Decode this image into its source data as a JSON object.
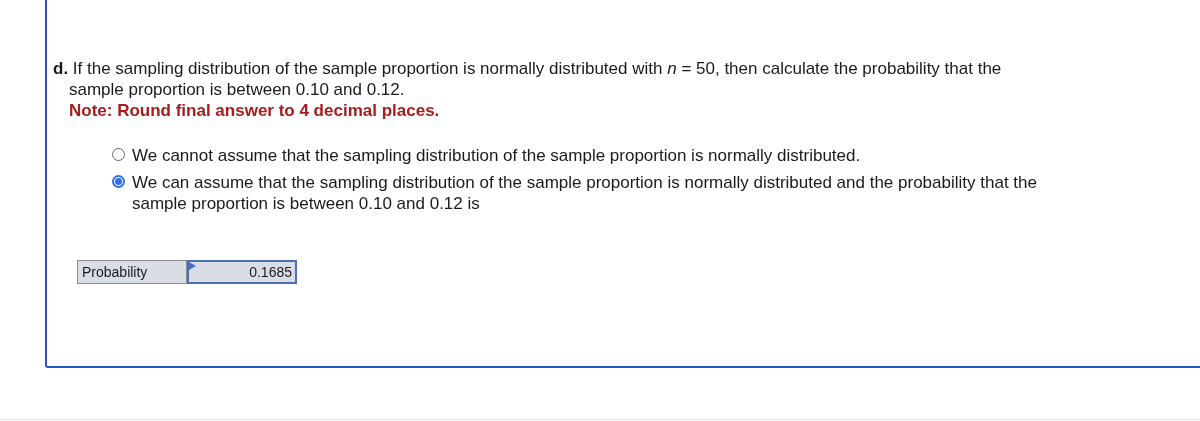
{
  "question": {
    "text": "**d.** If the sampling distribution of the sample proportion is normally distributed with *n* = 50, then calculate the probability that the sample proportion is between 0.10 and 0.12.",
    "note": "Note: Round final answer to 4 decimal places."
  },
  "options": [
    {
      "label": "We cannot assume that the sampling distribution of the sample proportion is normally distributed.",
      "selected": false
    },
    {
      "label": "We can assume that the sampling distribution of the sample proportion is normally distributed and the probability that the sample proportion is between 0.10 and 0.12 is",
      "selected": true
    }
  ],
  "answer_table": {
    "label": "Probability",
    "value": "0.1685"
  }
}
